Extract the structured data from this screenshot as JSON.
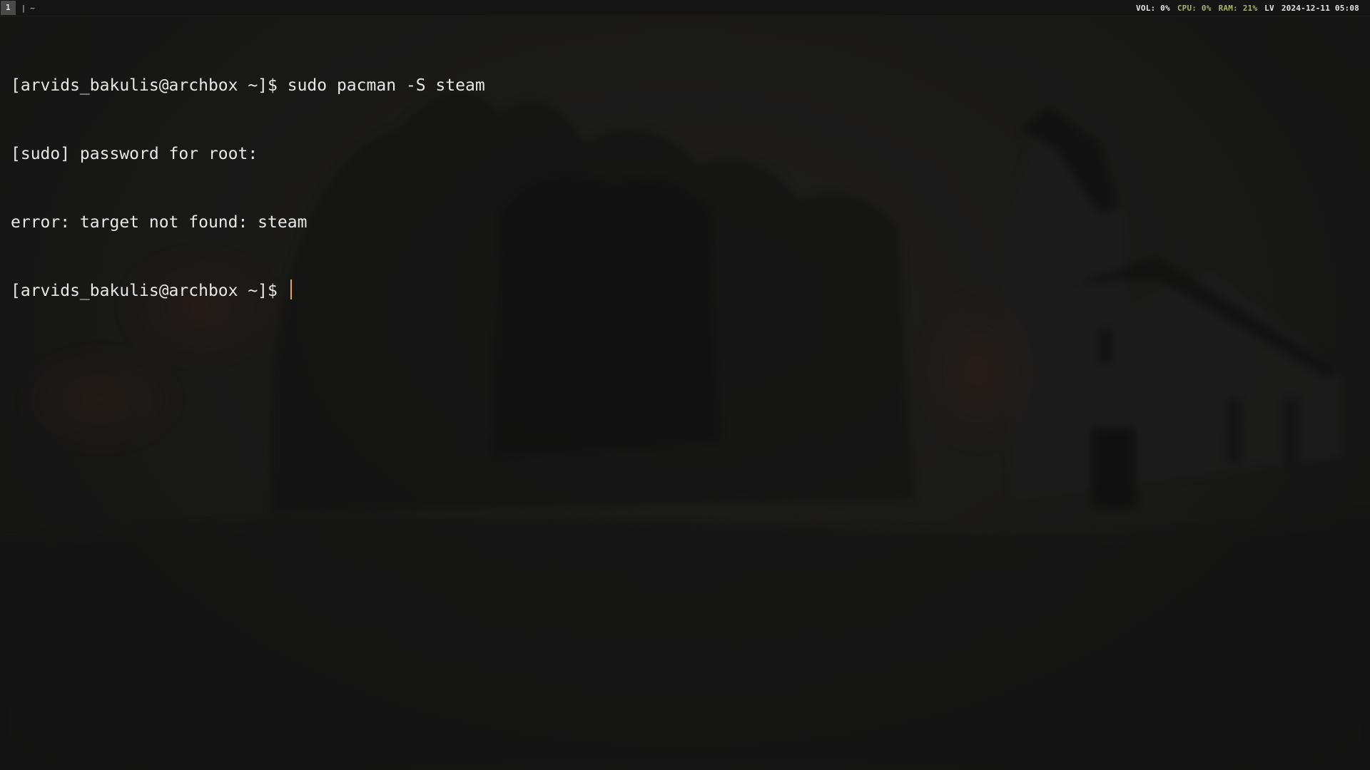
{
  "topbar": {
    "workspace": "1",
    "separator": "|",
    "window_title": "~",
    "status": {
      "volume": "VOL: 0%",
      "cpu": "CPU: 0%",
      "ram": "RAM: 21%",
      "layout": "LV",
      "clock": "2024-12-11 05:08"
    }
  },
  "terminal": {
    "lines": [
      "[arvids_bakulis@archbox ~]$ sudo pacman -S steam",
      "[sudo] password for root:",
      "error: target not found: steam",
      "[arvids_bakulis@archbox ~]$ "
    ],
    "cursor_color": "#e0a458"
  },
  "colors": {
    "bar_background": "#151515",
    "active_workspace": "#4a4a4a",
    "status_green": "#a7b46a",
    "terminal_text": "#e8e8e6"
  }
}
